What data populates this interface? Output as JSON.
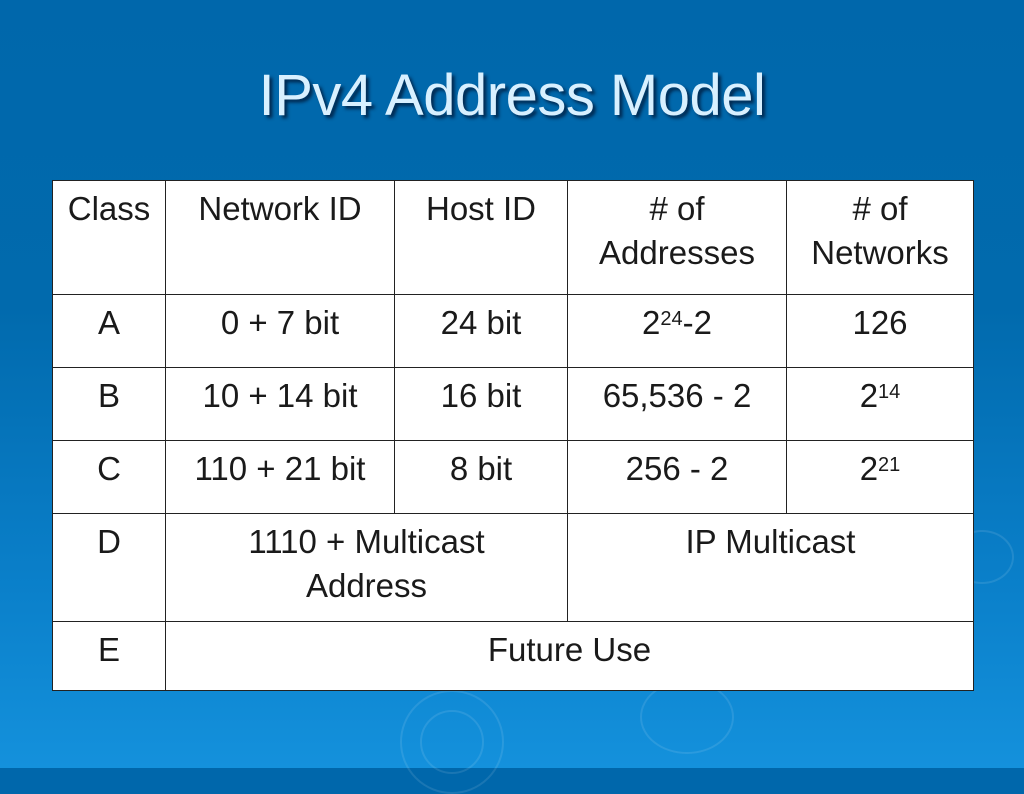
{
  "slide": {
    "title": "IPv4 Address Model",
    "colors": {
      "background": "#0067ab",
      "title_text": "#d8f0ff",
      "table_bg": "#ffffff"
    }
  },
  "table": {
    "headers": {
      "class": "Class",
      "network_id": "Network ID",
      "host_id": "Host ID",
      "num_addresses_line1": "# of",
      "num_addresses_line2": "Addresses",
      "num_networks_line1": "# of",
      "num_networks_line2": "Networks"
    },
    "rows": {
      "a": {
        "class": "A",
        "network_id": "0 + 7 bit",
        "host_id": "24 bit",
        "addresses_base": "2",
        "addresses_exp": "24",
        "addresses_suffix": "-2",
        "networks": "126"
      },
      "b": {
        "class": "B",
        "network_id": "10 + 14 bit",
        "host_id": "16 bit",
        "addresses": "65,536 - 2",
        "networks_base": "2",
        "networks_exp": "14"
      },
      "c": {
        "class": "C",
        "network_id": "110 + 21 bit",
        "host_id": "8 bit",
        "addresses": "256 - 2",
        "networks_base": "2",
        "networks_exp": "21"
      },
      "d": {
        "class": "D",
        "network_host_line1": "1110 + Multicast",
        "network_host_line2": "Address",
        "usage": "IP Multicast"
      },
      "e": {
        "class": "E",
        "usage": "Future Use"
      }
    }
  }
}
